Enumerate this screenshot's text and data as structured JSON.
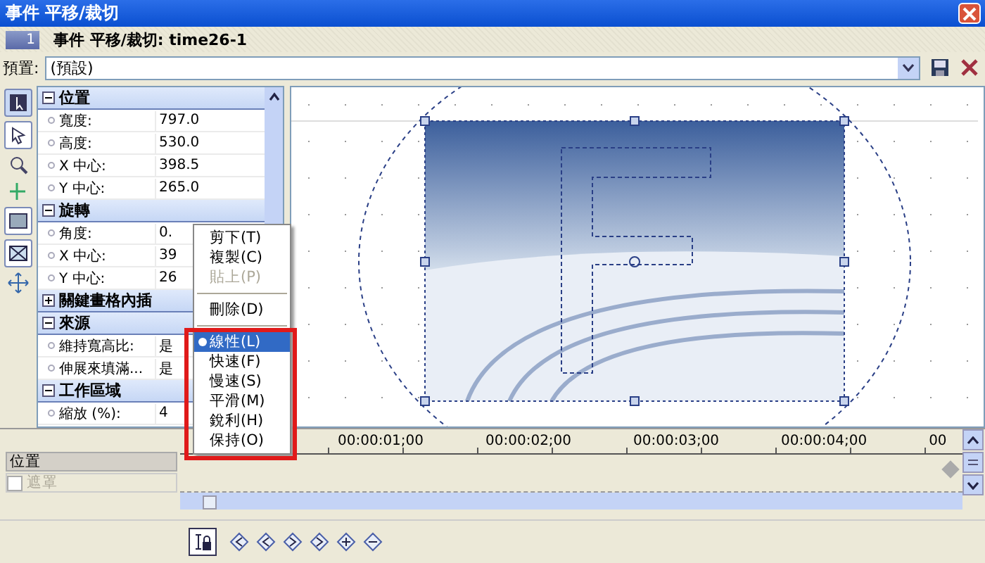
{
  "window": {
    "title": "事件 平移/裁切"
  },
  "header": {
    "number": "1",
    "title": "事件 平移/裁切: time26-1"
  },
  "preset": {
    "label": "預置:",
    "value": "(預設)"
  },
  "properties": [
    {
      "title": "位置",
      "expanded": true,
      "rows": [
        {
          "name": "寬度:",
          "value": "797.0"
        },
        {
          "name": "高度:",
          "value": "530.0"
        },
        {
          "name": "X 中心:",
          "value": "398.5"
        },
        {
          "name": "Y 中心:",
          "value": "265.0"
        }
      ]
    },
    {
      "title": "旋轉",
      "expanded": true,
      "rows": [
        {
          "name": "角度:",
          "value": "0."
        },
        {
          "name": "X 中心:",
          "value": "39"
        },
        {
          "name": "Y 中心:",
          "value": "26"
        }
      ]
    },
    {
      "title": "關鍵畫格內插",
      "expanded": false
    },
    {
      "title": "來源",
      "expanded": true,
      "rows": [
        {
          "name": "維持寬高比:",
          "value": "是"
        },
        {
          "name": "伸展來填滿...",
          "value": "是"
        }
      ]
    },
    {
      "title": "工作區域",
      "expanded": true,
      "rows": [
        {
          "name": "縮放 (%):",
          "value": "4"
        }
      ]
    }
  ],
  "context_menu": [
    {
      "kind": "item",
      "label": "剪下(T)",
      "disabled": false,
      "selected": false
    },
    {
      "kind": "item",
      "label": "複製(C)",
      "disabled": false,
      "selected": false
    },
    {
      "kind": "item",
      "label": "貼上(P)",
      "disabled": true,
      "selected": false
    },
    {
      "kind": "separator"
    },
    {
      "kind": "item",
      "label": "刪除(D)",
      "disabled": false,
      "selected": false
    },
    {
      "kind": "separator"
    },
    {
      "kind": "item",
      "label": "線性(L)",
      "disabled": false,
      "selected": true
    },
    {
      "kind": "item",
      "label": "快速(F)",
      "disabled": false,
      "selected": false
    },
    {
      "kind": "item",
      "label": "慢速(S)",
      "disabled": false,
      "selected": false
    },
    {
      "kind": "item",
      "label": "平滑(M)",
      "disabled": false,
      "selected": false
    },
    {
      "kind": "item",
      "label": "銳利(H)",
      "disabled": false,
      "selected": false
    },
    {
      "kind": "item",
      "label": "保持(O)",
      "disabled": false,
      "selected": false
    }
  ],
  "timeline": {
    "ruler": [
      "00:00:01;00",
      "00:00:02;00",
      "00:00:03;00",
      "00:00:04;00",
      "00"
    ],
    "track": {
      "label": "位置"
    },
    "mask": {
      "label": "遮罩",
      "checked": false,
      "disabled": true
    }
  }
}
